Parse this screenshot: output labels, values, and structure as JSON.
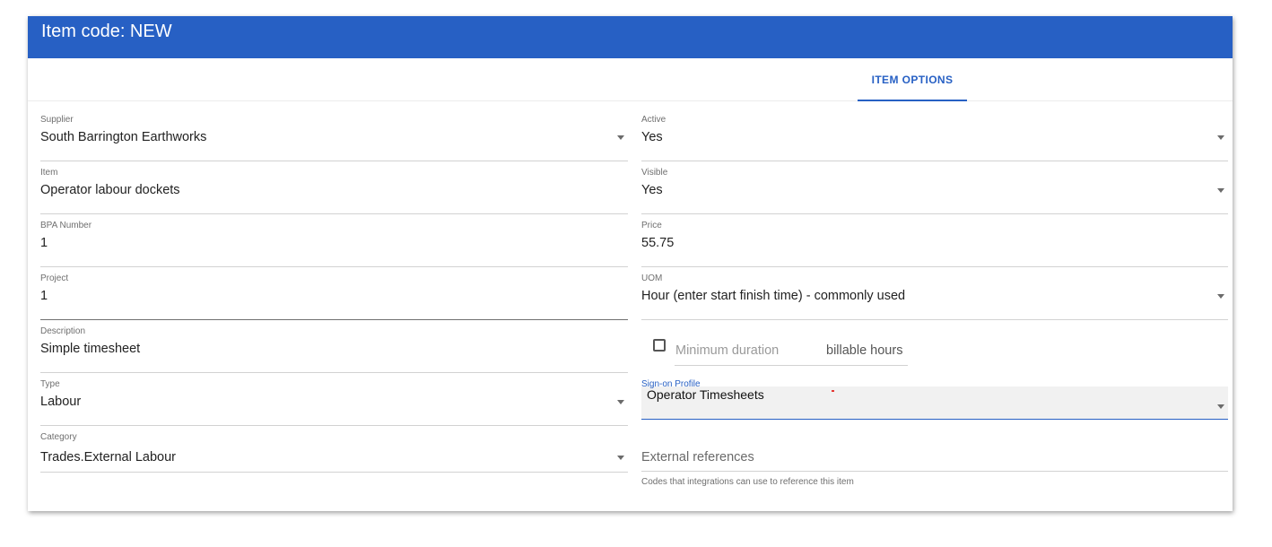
{
  "header": {
    "title": "Item code: NEW"
  },
  "tabs": [
    {
      "label": "ITEM OPTIONS",
      "active": true
    }
  ],
  "left_fields": {
    "supplier": {
      "label": "Supplier",
      "value": "South Barrington Earthworks"
    },
    "item": {
      "label": "Item",
      "value": "Operator labour dockets"
    },
    "bpa_number": {
      "label": "BPA Number",
      "value": "1"
    },
    "project": {
      "label": "Project",
      "value": "1"
    },
    "description": {
      "label": "Description",
      "value": "Simple timesheet"
    },
    "type": {
      "label": "Type",
      "value": "Labour"
    },
    "category": {
      "label": "Category",
      "value": "Trades.External Labour"
    }
  },
  "right_fields": {
    "active": {
      "label": "Active",
      "value": "Yes"
    },
    "visible": {
      "label": "Visible",
      "value": "Yes"
    },
    "price": {
      "label": "Price",
      "value": "55.75"
    },
    "uom": {
      "label": "UOM",
      "value": "Hour (enter start finish time) - commonly used"
    },
    "minimum_duration": {
      "placeholder": "Minimum duration",
      "suffix": "billable hours",
      "checked": false
    },
    "sign_on_profile": {
      "label": "Sign-on Profile",
      "value": "Operator Timesheets"
    },
    "external_references": {
      "placeholder": "External references",
      "hint": "Codes that integrations can use to reference this item"
    }
  },
  "colors": {
    "primary": "#2760c4",
    "header_text": "#ffffff",
    "accent_mark": "#e53935"
  },
  "icons": {
    "dropdown": "chevron-down-icon",
    "checkbox": "checkbox-icon"
  }
}
